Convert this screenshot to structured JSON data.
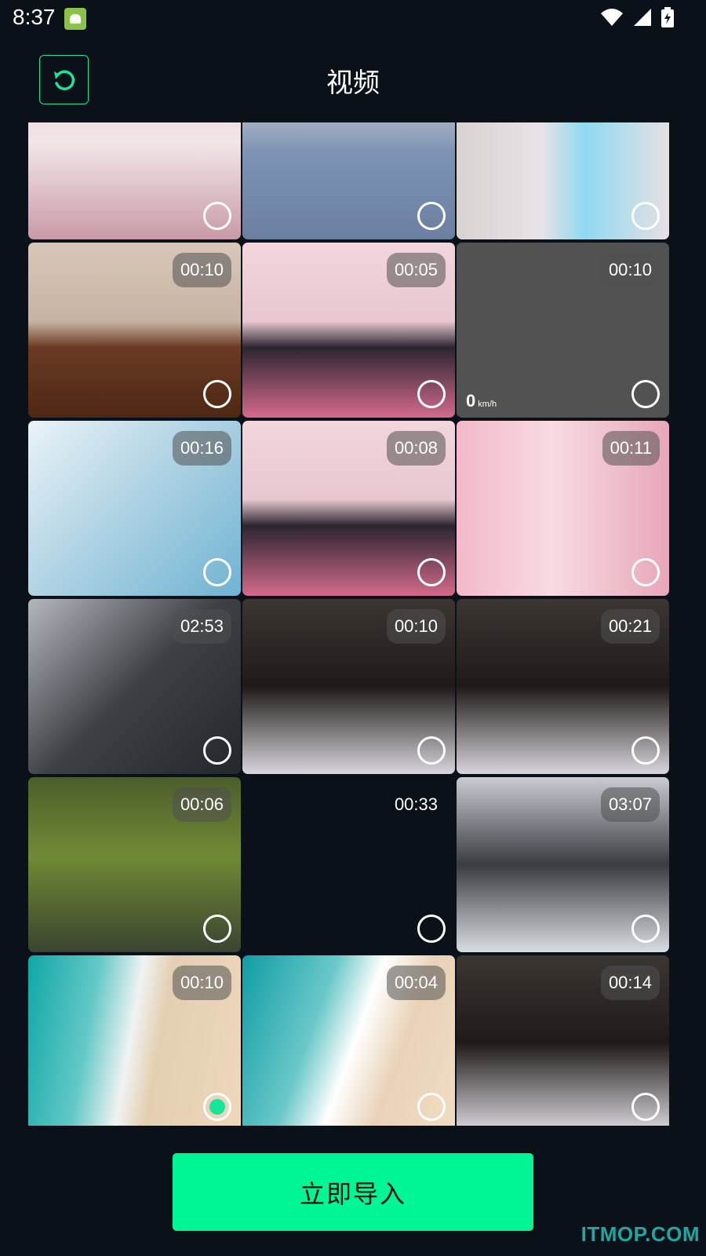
{
  "status_bar": {
    "time": "8:37",
    "icons": [
      "app-notification-icon",
      "wifi-icon",
      "cell-signal-icon",
      "battery-charging-icon"
    ]
  },
  "header": {
    "back_icon": "undo-arrow-icon",
    "title": "视频"
  },
  "colors": {
    "accent": "#00f594",
    "background": "#0b1118",
    "back_border": "#1ee39a"
  },
  "tiles": [
    {
      "duration": "",
      "image": "anime-girl-pink-top",
      "selected": false
    },
    {
      "duration": "",
      "image": "woman-blue-shirt",
      "selected": false
    },
    {
      "duration": "",
      "image": "anime-character-green-eye",
      "selected": false
    },
    {
      "duration": "00:10",
      "image": "girl-leaning-on-wood",
      "selected": false
    },
    {
      "duration": "00:05",
      "image": "anime-girl-pink-room",
      "selected": false
    },
    {
      "duration": "00:10",
      "image": "gray-blank",
      "selected": false,
      "speed_value": "0",
      "speed_unit": "km/h"
    },
    {
      "duration": "00:16",
      "image": "ice-water-surface",
      "selected": false
    },
    {
      "duration": "00:08",
      "image": "anime-girl-pink-room",
      "selected": false
    },
    {
      "duration": "00:11",
      "image": "anime-legs-pink-curtain",
      "selected": false
    },
    {
      "duration": "02:53",
      "image": "dark-hair-portrait",
      "selected": false
    },
    {
      "duration": "00:10",
      "image": "anime-girl-dark-hair",
      "selected": false
    },
    {
      "duration": "00:21",
      "image": "anime-girl-dark-hair",
      "selected": false
    },
    {
      "duration": "00:06",
      "image": "forest-river",
      "selected": false
    },
    {
      "duration": "00:33",
      "image": "black-blank",
      "selected": false
    },
    {
      "duration": "03:07",
      "image": "dark-hair-portrait-flipped",
      "selected": false
    },
    {
      "duration": "00:10",
      "image": "beach-waves",
      "selected": true
    },
    {
      "duration": "00:04",
      "image": "beach-waves-close",
      "selected": false
    },
    {
      "duration": "00:14",
      "image": "anime-girl-dark-hair",
      "selected": false
    }
  ],
  "import_button": {
    "label": "立即导入"
  },
  "watermark": "ITMOP.COM"
}
